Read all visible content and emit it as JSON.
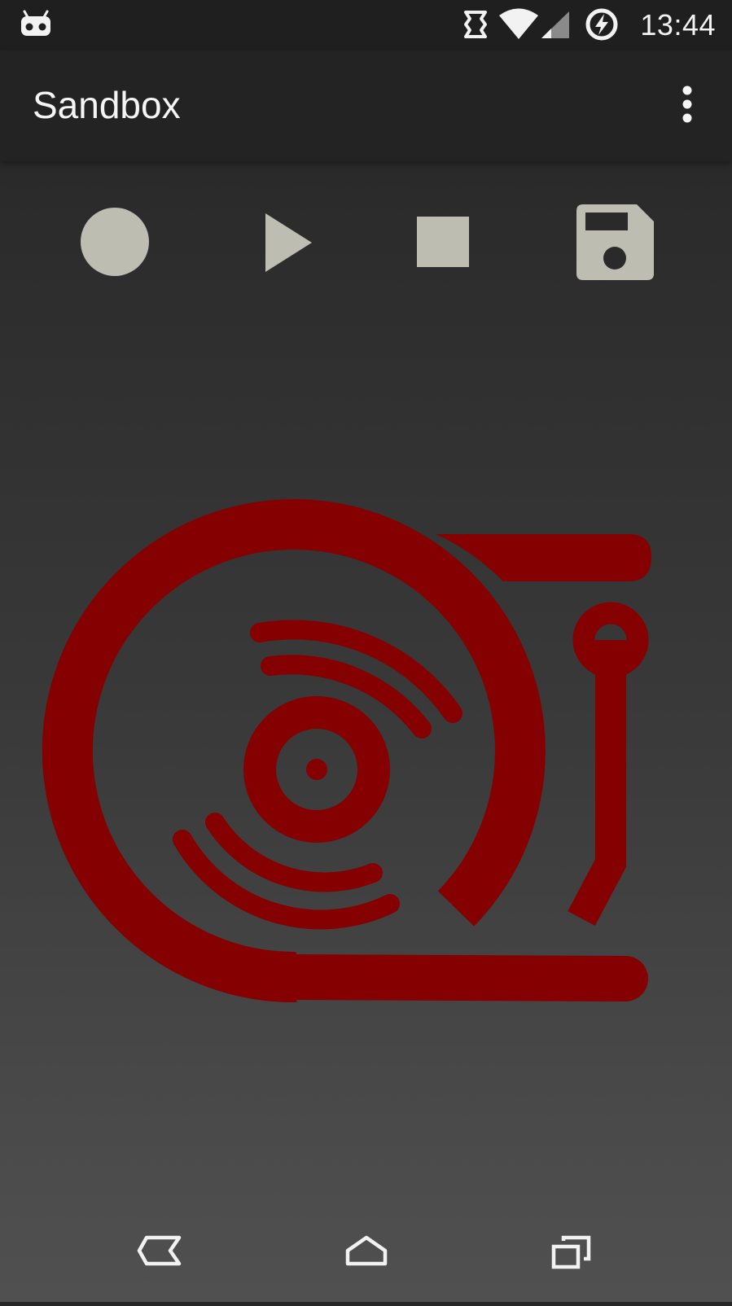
{
  "status_bar": {
    "time": "13:44",
    "icons": [
      "android-icon",
      "sync-icon",
      "wifi-icon",
      "signal-icon",
      "battery-charging-icon"
    ]
  },
  "app_bar": {
    "title": "Sandbox",
    "overflow_icon": "more-vert-icon"
  },
  "transport": {
    "buttons": [
      "record-icon",
      "play-icon",
      "stop-icon",
      "save-icon"
    ],
    "icon_color": "#bdbdb2"
  },
  "logo": {
    "icon": "turntable-icon",
    "color": "#850000"
  },
  "nav_bar": {
    "buttons": [
      "back-icon",
      "home-icon",
      "recents-icon"
    ]
  }
}
